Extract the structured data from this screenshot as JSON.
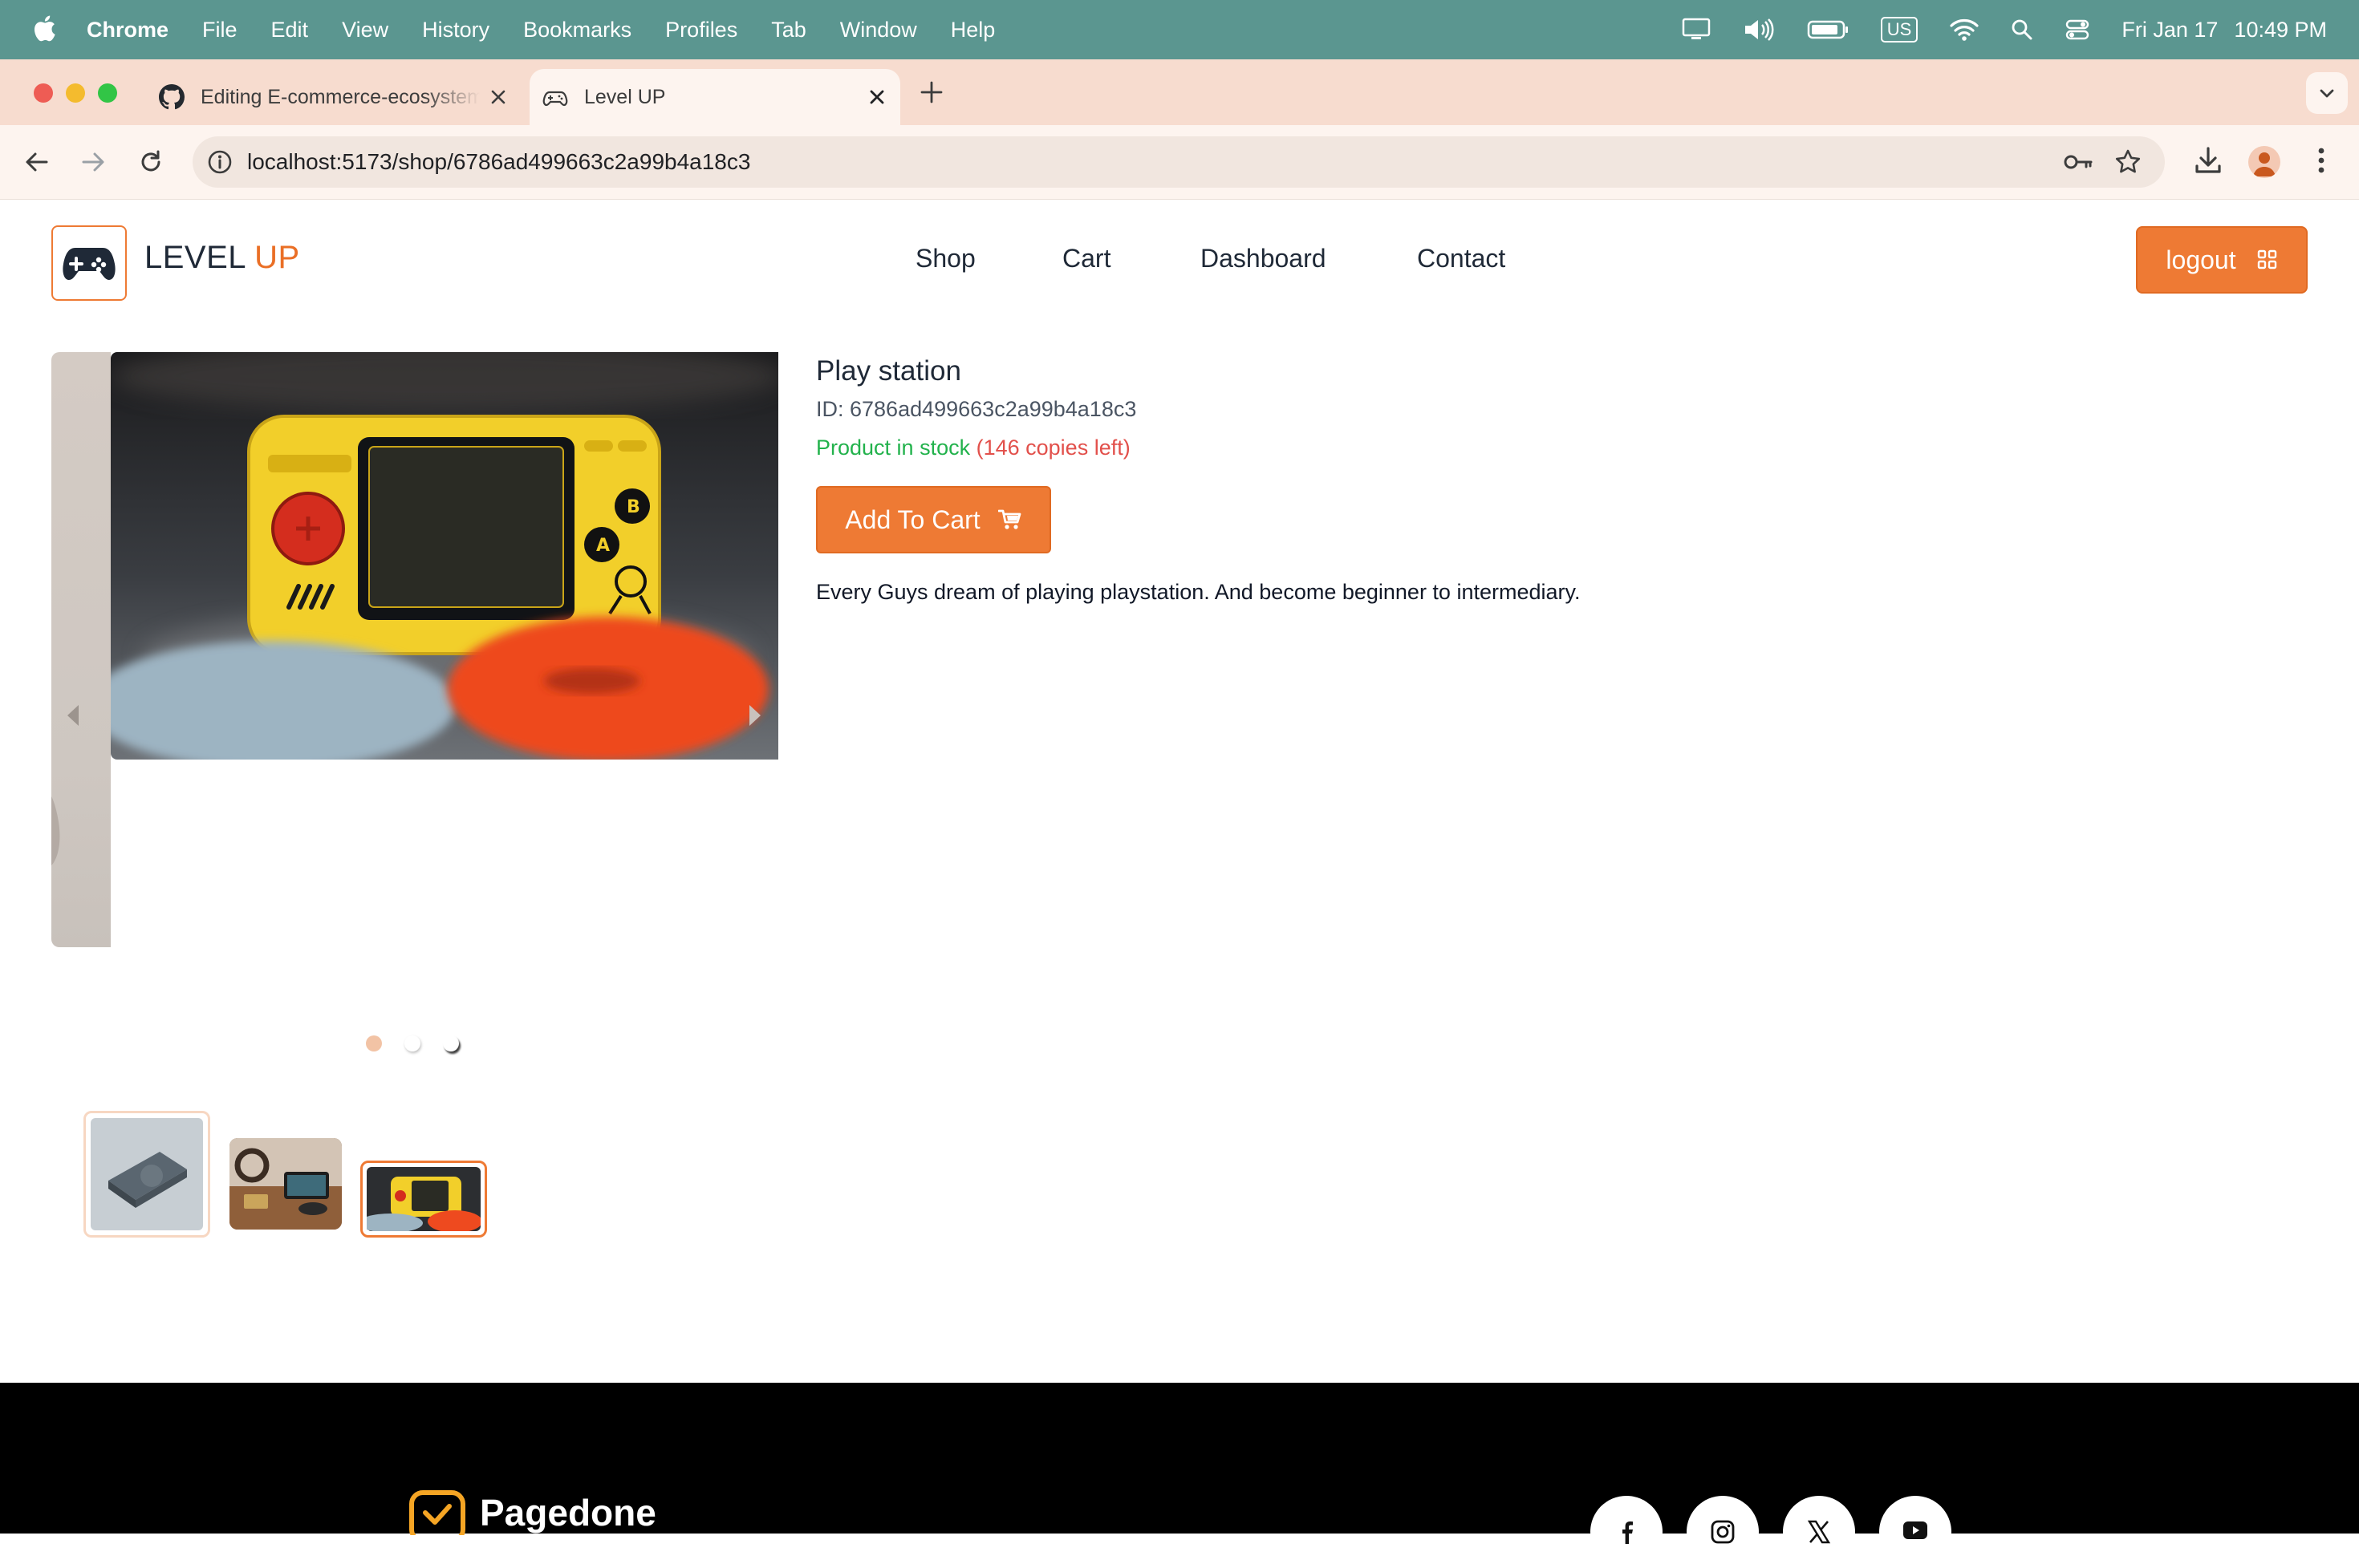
{
  "menubar": {
    "app": "Chrome",
    "items": [
      "File",
      "Edit",
      "View",
      "History",
      "Bookmarks",
      "Profiles",
      "Tab",
      "Window",
      "Help"
    ],
    "input_source": "US",
    "date": "Fri Jan 17",
    "time": "10:49 PM"
  },
  "tabs": [
    {
      "title": "Editing E-commerce-ecosystem",
      "icon": "github-icon"
    },
    {
      "title": "Level UP",
      "icon": "gamepad-icon"
    }
  ],
  "address_bar": {
    "host": "localhost",
    "path": ":5173/shop/6786ad499663c2a99b4a18c3"
  },
  "site": {
    "brand_main": "LEVEL",
    "brand_accent": "UP",
    "nav": [
      "Shop",
      "Cart",
      "Dashboard",
      "Contact"
    ],
    "logout_label": "logout",
    "accent_color": "#ee7a34"
  },
  "product": {
    "name": "Play station",
    "id_label": "ID: 6786ad499663c2a99b4a18c3",
    "stock_text": "Product in stock",
    "copies_text": "(146 copies left)",
    "add_to_cart_label": "Add To Cart",
    "description": "Every Guys dream of playing playstation. And become beginner to intermediary."
  },
  "carousel": {
    "slide_count": 3,
    "active_index": 2
  },
  "footer": {
    "brand": "Pagedone",
    "socials": [
      "facebook-icon",
      "instagram-icon",
      "x-icon",
      "youtube-icon"
    ]
  }
}
